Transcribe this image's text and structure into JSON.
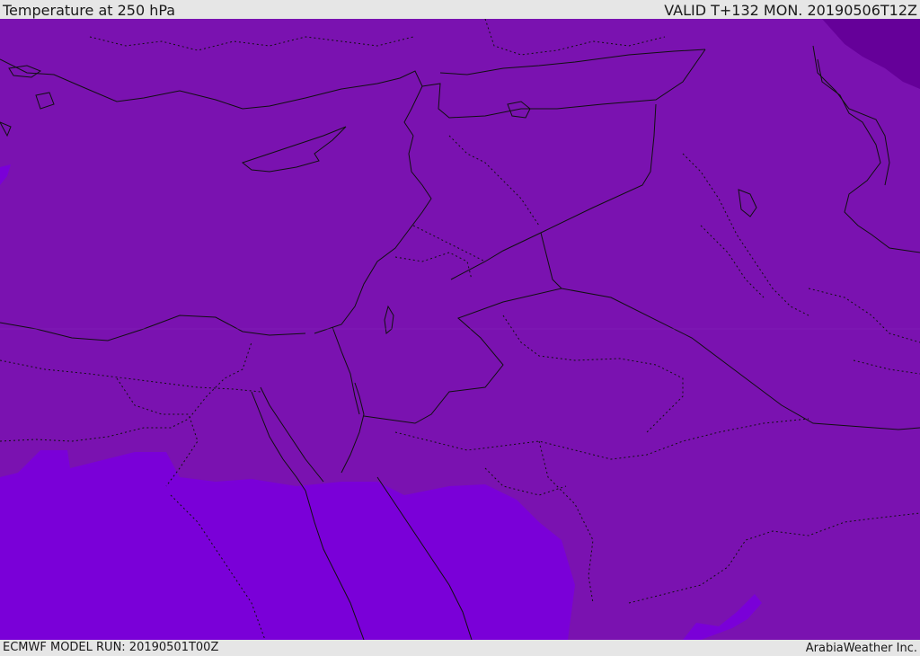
{
  "header": {
    "title": "Temperature at 250 hPa",
    "valid": "VALID T+132 MON. 20190506T12Z"
  },
  "footer": {
    "model_run": "ECMWF MODEL RUN: 20190501T00Z",
    "brand": "ArabiaWeather Inc."
  },
  "colors": {
    "base_fill": "#7a12b0",
    "warm_region_fill": "#7a00d8",
    "cold_region_fill": "#650099",
    "coastline": "#101010"
  }
}
